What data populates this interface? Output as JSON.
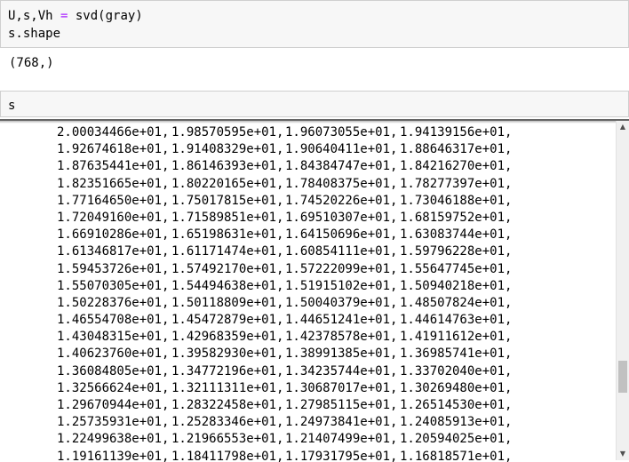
{
  "cell1": {
    "line1_pre": "U,s,Vh ",
    "line1_op": "=",
    "line1_post": " svd(gray)",
    "line2": "s.shape"
  },
  "output1": "(768,)",
  "cell2": {
    "line1": "s"
  },
  "array_rows": [
    [
      "2.00034466e+01,",
      "1.98570595e+01,",
      "1.96073055e+01,",
      "1.94139156e+01,"
    ],
    [
      "1.92674618e+01,",
      "1.91408329e+01,",
      "1.90640411e+01,",
      "1.88646317e+01,"
    ],
    [
      "1.87635441e+01,",
      "1.86146393e+01,",
      "1.84384747e+01,",
      "1.84216270e+01,"
    ],
    [
      "1.82351665e+01,",
      "1.80220165e+01,",
      "1.78408375e+01,",
      "1.78277397e+01,"
    ],
    [
      "1.77164650e+01,",
      "1.75017815e+01,",
      "1.74520226e+01,",
      "1.73046188e+01,"
    ],
    [
      "1.72049160e+01,",
      "1.71589851e+01,",
      "1.69510307e+01,",
      "1.68159752e+01,"
    ],
    [
      "1.66910286e+01,",
      "1.65198631e+01,",
      "1.64150696e+01,",
      "1.63083744e+01,"
    ],
    [
      "1.61346817e+01,",
      "1.61171474e+01,",
      "1.60854111e+01,",
      "1.59796228e+01,"
    ],
    [
      "1.59453726e+01,",
      "1.57492170e+01,",
      "1.57222099e+01,",
      "1.55647745e+01,"
    ],
    [
      "1.55070305e+01,",
      "1.54494638e+01,",
      "1.51915102e+01,",
      "1.50940218e+01,"
    ],
    [
      "1.50228376e+01,",
      "1.50118809e+01,",
      "1.50040379e+01,",
      "1.48507824e+01,"
    ],
    [
      "1.46554708e+01,",
      "1.45472879e+01,",
      "1.44651241e+01,",
      "1.44614763e+01,"
    ],
    [
      "1.43048315e+01,",
      "1.42968359e+01,",
      "1.42378578e+01,",
      "1.41911612e+01,"
    ],
    [
      "1.40623760e+01,",
      "1.39582930e+01,",
      "1.38991385e+01,",
      "1.36985741e+01,"
    ],
    [
      "1.36084805e+01,",
      "1.34772196e+01,",
      "1.34235744e+01,",
      "1.33702040e+01,"
    ],
    [
      "1.32566624e+01,",
      "1.32111311e+01,",
      "1.30687017e+01,",
      "1.30269480e+01,"
    ],
    [
      "1.29670944e+01,",
      "1.28322458e+01,",
      "1.27985115e+01,",
      "1.26514530e+01,"
    ],
    [
      "1.25735931e+01,",
      "1.25283346e+01,",
      "1.24973841e+01,",
      "1.24085913e+01,"
    ],
    [
      "1.22499638e+01,",
      "1.21966553e+01,",
      "1.21407499e+01,",
      "1.20594025e+01,"
    ],
    [
      "1.19161139e+01,",
      "1.18411798e+01,",
      "1.17931795e+01,",
      "1.16818571e+01,"
    ]
  ],
  "scrollbar": {
    "position": 0.7,
    "up_icon": "▲",
    "down_icon": "▼"
  }
}
